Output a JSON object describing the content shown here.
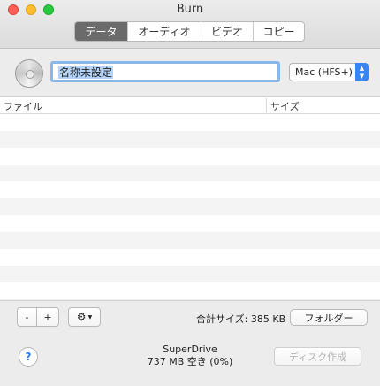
{
  "window": {
    "title": "Burn"
  },
  "tabs": [
    {
      "label": "データ",
      "active": true
    },
    {
      "label": "オーディオ",
      "active": false
    },
    {
      "label": "ビデオ",
      "active": false
    },
    {
      "label": "コピー",
      "active": false
    }
  ],
  "disc": {
    "name": "名称未設定",
    "filesystem": "Mac (HFS+)"
  },
  "list": {
    "columns": [
      "ファイル",
      "サイズ"
    ],
    "rows": []
  },
  "bottom": {
    "minus_label": "-",
    "plus_label": "+",
    "gear_icon": "gear-icon",
    "total_size": "合計サイズ: 385 KB",
    "folder_label": "フォルダー",
    "help_label": "?",
    "drive_name": "SuperDrive",
    "drive_free": "737 MB 空き (0%)",
    "burn_label": "ディスク作成"
  },
  "colors": {
    "accent": "#3b84f4",
    "selected_tab": "#6b6b6b",
    "field_focus": "#8bb6e8"
  }
}
